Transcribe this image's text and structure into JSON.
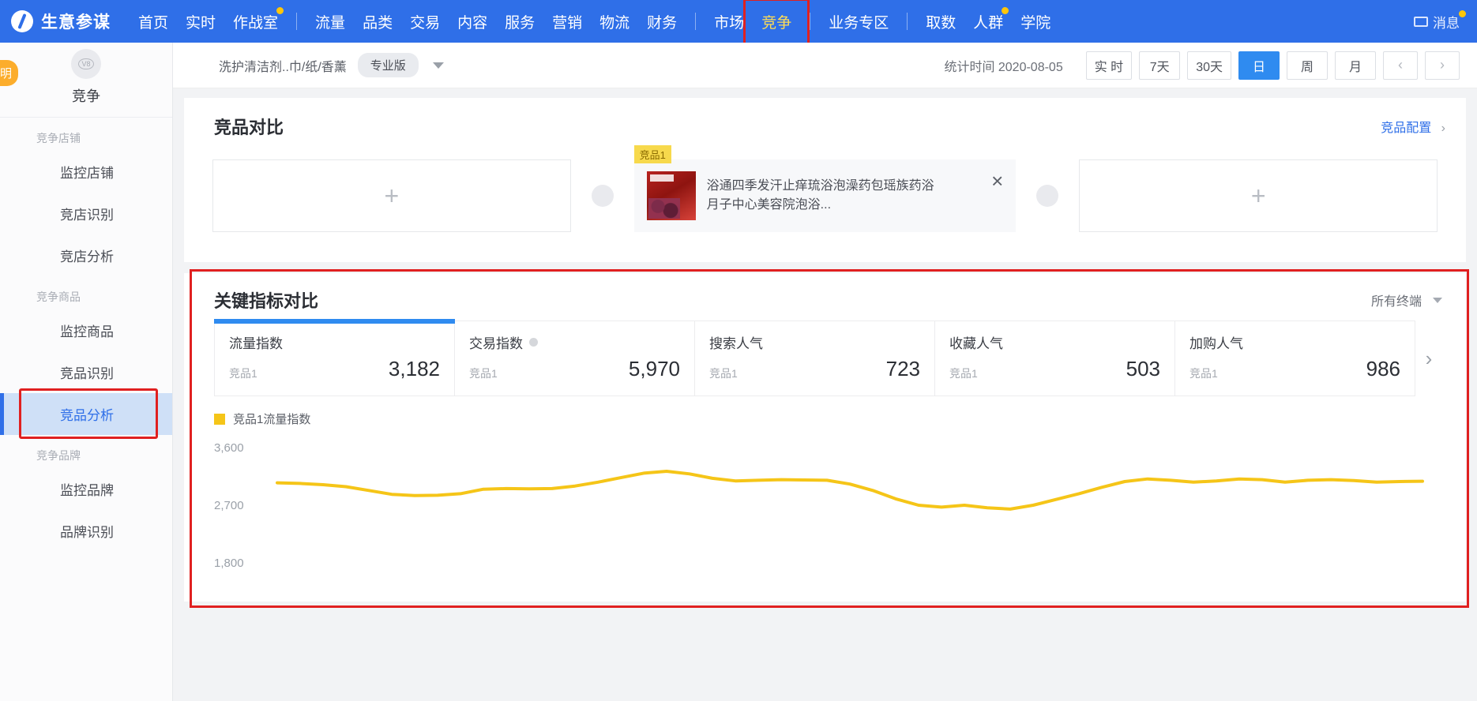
{
  "topnav": {
    "brand": "生意参谋",
    "primary": [
      {
        "label": "首页",
        "dot": false
      },
      {
        "label": "实时",
        "dot": false
      },
      {
        "label": "作战室",
        "dot": true
      }
    ],
    "group1": [
      {
        "label": "流量"
      },
      {
        "label": "品类"
      },
      {
        "label": "交易"
      },
      {
        "label": "内容"
      },
      {
        "label": "服务"
      },
      {
        "label": "营销"
      },
      {
        "label": "物流"
      },
      {
        "label": "财务"
      }
    ],
    "group2": [
      {
        "label": "市场",
        "highlighted": false
      },
      {
        "label": "竞争",
        "highlighted": true
      }
    ],
    "group3": [
      {
        "label": "业务专区"
      }
    ],
    "group4": [
      {
        "label": "取数",
        "dot": false
      },
      {
        "label": "人群",
        "dot": true
      },
      {
        "label": "学院",
        "dot": false
      }
    ],
    "message": {
      "label": "消息",
      "icon": "mail-icon"
    }
  },
  "sidebar": {
    "avatar_text": "V8",
    "title": "竞争",
    "float_badge": "明",
    "groups": [
      {
        "group_label": "竞争店铺",
        "items": [
          {
            "label": "监控店铺",
            "active": false
          },
          {
            "label": "竞店识别",
            "active": false
          },
          {
            "label": "竞店分析",
            "active": false
          }
        ]
      },
      {
        "group_label": "竞争商品",
        "items": [
          {
            "label": "监控商品",
            "active": false
          },
          {
            "label": "竞品识别",
            "active": false
          },
          {
            "label": "竞品分析",
            "active": true
          }
        ]
      },
      {
        "group_label": "竞争品牌",
        "items": [
          {
            "label": "监控品牌",
            "active": false
          },
          {
            "label": "品牌识别",
            "active": false
          }
        ]
      }
    ]
  },
  "filterbar": {
    "category": "洗护清洁剂..巾/纸/香薰",
    "edition_badge": "专业版",
    "caret": "chevron-down-icon",
    "stat_time_label": "统计时间 2020-08-05",
    "range_buttons": [
      {
        "label": "实 时",
        "active": false
      },
      {
        "label": "7天",
        "active": false
      },
      {
        "label": "30天",
        "active": false
      },
      {
        "label": "日",
        "active": true
      },
      {
        "label": "周",
        "active": false
      },
      {
        "label": "月",
        "active": false
      }
    ],
    "prev": "‹",
    "next": "›"
  },
  "compare_panel": {
    "title": "竞品对比",
    "config_link": "竞品配置",
    "config_chevron": "›",
    "add_placeholder": "+",
    "product": {
      "badge": "竞品1",
      "title": "浴通四季发汗止痒琉浴泡澡药包瑶族药浴月子中心美容院泡浴...",
      "close": "×"
    }
  },
  "metrics_panel": {
    "title": "关键指标对比",
    "terminal_select": "所有终端",
    "next_arrow": "›",
    "cards": [
      {
        "name": "流量指数",
        "sub": "竞品1",
        "value": "3,182",
        "active": true,
        "has_dot": false
      },
      {
        "name": "交易指数",
        "sub": "竞品1",
        "value": "5,970",
        "active": false,
        "has_dot": true
      },
      {
        "name": "搜索人气",
        "sub": "竞品1",
        "value": "723",
        "active": false,
        "has_dot": false
      },
      {
        "name": "收藏人气",
        "sub": "竞品1",
        "value": "503",
        "active": false,
        "has_dot": false
      },
      {
        "name": "加购人气",
        "sub": "竞品1",
        "value": "986",
        "active": false,
        "has_dot": false
      }
    ]
  },
  "chart_data": {
    "type": "line",
    "title": "",
    "legend": [
      {
        "name": "竞品1流量指数",
        "color": "#f5c518"
      }
    ],
    "legend_position": "top-left",
    "xlabel": "",
    "ylabel": "",
    "ylim": [
      1800,
      3600
    ],
    "yticks": [
      "3,600",
      "2,700",
      "1,800"
    ],
    "grid": false,
    "series": [
      {
        "name": "竞品1流量指数",
        "color": "#f5c518",
        "values": [
          3050,
          3040,
          3020,
          2990,
          2930,
          2870,
          2850,
          2855,
          2880,
          2950,
          2960,
          2955,
          2960,
          3000,
          3060,
          3130,
          3200,
          3230,
          3190,
          3120,
          3080,
          3090,
          3100,
          3095,
          3090,
          3030,
          2930,
          2800,
          2700,
          2670,
          2700,
          2660,
          2640,
          2700,
          2790,
          2880,
          2980,
          3070,
          3110,
          3090,
          3060,
          3080,
          3110,
          3100,
          3060,
          3090,
          3100,
          3085,
          3060,
          3070,
          3075
        ]
      }
    ]
  },
  "colors": {
    "brand_blue": "#2f6fe8",
    "accent_blue": "#2f8bf0",
    "annotation_red": "#e02020",
    "chart_yellow": "#f5c518",
    "badge_yellow": "#f7d94c"
  }
}
